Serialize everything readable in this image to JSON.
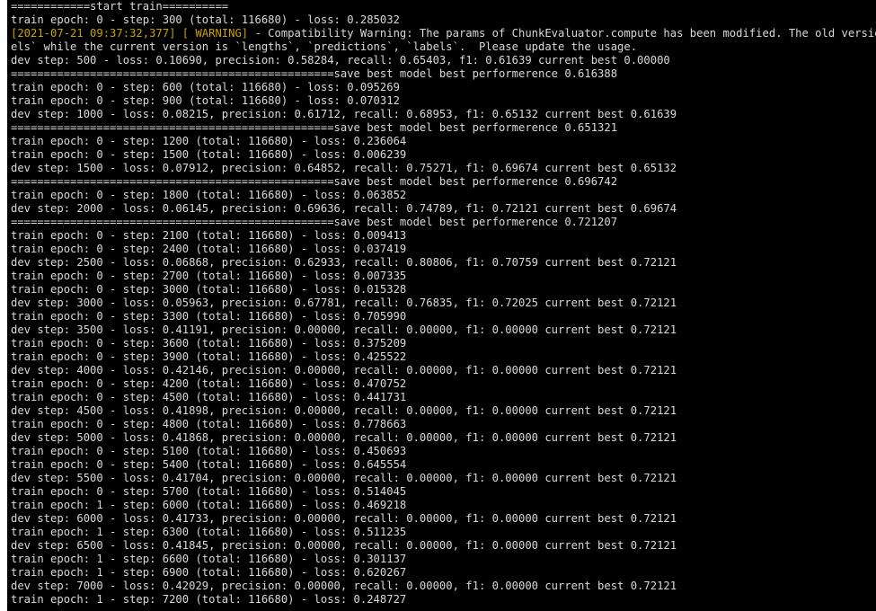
{
  "terminal": {
    "colors": {
      "background": "#000000",
      "text": "#d9d9d9",
      "warning": "#c8a200"
    },
    "lines": [
      "============start train==========",
      "train epoch: 0 - step: 300 (total: 116680) - loss: 0.285032",
      {
        "timestamp": "[2021-07-21 09:37:32,377]",
        "level": " [ WARNING]",
        "message": " - Compatibility Warning: The params of ChunkEvaluator.compute has been modified. The old version is `"
      },
      "els` while the current version is `lengths`, `predictions`, `labels`.  Please update the usage.",
      "dev step: 500 - loss: 0.10690, precision: 0.58284, recall: 0.65403, f1: 0.61639 current best 0.00000",
      "=================================================save best model best performerence 0.616388",
      "train epoch: 0 - step: 600 (total: 116680) - loss: 0.095269",
      "train epoch: 0 - step: 900 (total: 116680) - loss: 0.070312",
      "dev step: 1000 - loss: 0.08215, precision: 0.61712, recall: 0.68953, f1: 0.65132 current best 0.61639",
      "=================================================save best model best performerence 0.651321",
      "train epoch: 0 - step: 1200 (total: 116680) - loss: 0.236064",
      "train epoch: 0 - step: 1500 (total: 116680) - loss: 0.006239",
      "dev step: 1500 - loss: 0.07912, precision: 0.64852, recall: 0.75271, f1: 0.69674 current best 0.65132",
      "=================================================save best model best performerence 0.696742",
      "train epoch: 0 - step: 1800 (total: 116680) - loss: 0.063852",
      "dev step: 2000 - loss: 0.06145, precision: 0.69636, recall: 0.74789, f1: 0.72121 current best 0.69674",
      "=================================================save best model best performerence 0.721207",
      "train epoch: 0 - step: 2100 (total: 116680) - loss: 0.009413",
      "train epoch: 0 - step: 2400 (total: 116680) - loss: 0.037419",
      "dev step: 2500 - loss: 0.06868, precision: 0.62933, recall: 0.80806, f1: 0.70759 current best 0.72121",
      "train epoch: 0 - step: 2700 (total: 116680) - loss: 0.007335",
      "train epoch: 0 - step: 3000 (total: 116680) - loss: 0.015328",
      "dev step: 3000 - loss: 0.05963, precision: 0.67781, recall: 0.76835, f1: 0.72025 current best 0.72121",
      "train epoch: 0 - step: 3300 (total: 116680) - loss: 0.705990",
      "dev step: 3500 - loss: 0.41191, precision: 0.00000, recall: 0.00000, f1: 0.00000 current best 0.72121",
      "train epoch: 0 - step: 3600 (total: 116680) - loss: 0.375209",
      "train epoch: 0 - step: 3900 (total: 116680) - loss: 0.425522",
      "dev step: 4000 - loss: 0.42146, precision: 0.00000, recall: 0.00000, f1: 0.00000 current best 0.72121",
      "train epoch: 0 - step: 4200 (total: 116680) - loss: 0.470752",
      "train epoch: 0 - step: 4500 (total: 116680) - loss: 0.441731",
      "dev step: 4500 - loss: 0.41898, precision: 0.00000, recall: 0.00000, f1: 0.00000 current best 0.72121",
      "train epoch: 0 - step: 4800 (total: 116680) - loss: 0.778663",
      "dev step: 5000 - loss: 0.41868, precision: 0.00000, recall: 0.00000, f1: 0.00000 current best 0.72121",
      "train epoch: 0 - step: 5100 (total: 116680) - loss: 0.450693",
      "train epoch: 0 - step: 5400 (total: 116680) - loss: 0.645554",
      "dev step: 5500 - loss: 0.41704, precision: 0.00000, recall: 0.00000, f1: 0.00000 current best 0.72121",
      "train epoch: 0 - step: 5700 (total: 116680) - loss: 0.514045",
      "train epoch: 1 - step: 6000 (total: 116680) - loss: 0.469218",
      "dev step: 6000 - loss: 0.41733, precision: 0.00000, recall: 0.00000, f1: 0.00000 current best 0.72121",
      "train epoch: 1 - step: 6300 (total: 116680) - loss: 0.511235",
      "dev step: 6500 - loss: 0.41845, precision: 0.00000, recall: 0.00000, f1: 0.00000 current best 0.72121",
      "train epoch: 1 - step: 6600 (total: 116680) - loss: 0.301137",
      "train epoch: 1 - step: 6900 (total: 116680) - loss: 0.620267",
      "dev step: 7000 - loss: 0.42029, precision: 0.00000, recall: 0.00000, f1: 0.00000 current best 0.72121",
      "train epoch: 1 - step: 7200 (total: 116680) - loss: 0.248727"
    ]
  }
}
